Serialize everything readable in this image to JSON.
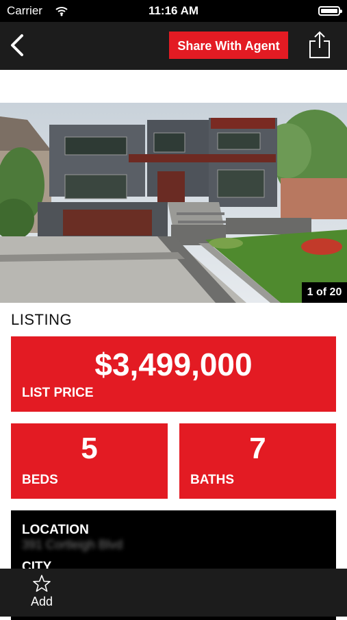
{
  "status_bar": {
    "carrier": "Carrier",
    "time": "11:16 AM"
  },
  "nav": {
    "share_agent_label": "Share With Agent",
    "icons": [
      "back-chevron-icon",
      "share-icon"
    ]
  },
  "gallery": {
    "counter": "1 of 20"
  },
  "listing": {
    "section_title": "LISTING",
    "price_value": "$3,499,000",
    "price_label": "LIST PRICE",
    "beds_value": "5",
    "beds_label": "BEDS",
    "baths_value": "7",
    "baths_label": "BATHS",
    "location_label": "LOCATION",
    "location_address": "391 Cortleigh Blvd",
    "city_label": "CITY"
  },
  "tab_bar": {
    "add_label": "Add",
    "icon": "star-icon"
  },
  "colors": {
    "accent": "#e31b23",
    "nav": "#1c1c1c",
    "dark": "#000000"
  }
}
